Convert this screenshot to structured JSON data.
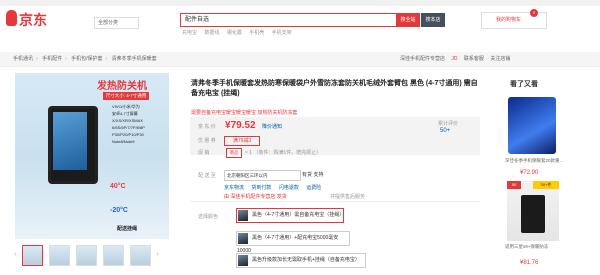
{
  "header": {
    "logo_text": "京东",
    "category_button": "全部分类",
    "search_value": "配件自选",
    "search_button": "搜全站",
    "search_shop_button": "搜本店",
    "hot_words": [
      "充电宝",
      "数据线",
      "钢化膜",
      "手机壳",
      "手机支架"
    ],
    "cart_label": "我的购物车",
    "cart_count": "0"
  },
  "breadcrumb": [
    "手机通讯",
    "手机配件",
    "手机包/保护套",
    "清弗冬季手机保暖套"
  ],
  "shop_links": [
    "深佳手机配件专营店",
    "JD",
    "联系客服",
    "关注店铺"
  ],
  "gallery": {
    "img_title": "发热防关机",
    "img_sub": "尺寸大小: 4-7寸通用",
    "img_specs": [
      "VIVO/小米/华为",
      "安卓4-7寸屏幕",
      "X/XS/XR/XSMAX",
      "6/6S/6P/7/7P/8/8P",
      "P30/P20/P10/P30",
      "Note8/Note9",
      "配件齐全"
    ],
    "hot_temp": "40°C",
    "cold_temp": "-20°C",
    "foot": "配送挂绳",
    "thumb_count": 5
  },
  "product": {
    "title": "清弗冬季手机保暖套发热防寒保暖袋户外雪防冻套防关机毛绒外套臂包 黑色 (4-7寸通用) 需自备充电宝 (挂绳)",
    "promo_text": "需要自备充电宝暖宝暖宝暖宝 加热防关机防冻套",
    "price_label": "京 东 价",
    "currency": "¥",
    "price": "79.52",
    "notify": "降价通知",
    "cumulative_label": "累计评价",
    "cumulative_value": "50+",
    "coupon_label": "优 惠 券",
    "coupon_tag": "满79减3",
    "promo_label": "促 销",
    "promo_tag": "赠品",
    "promo_desc": "× 1 （条件：购满1件，赠完即止）",
    "delivery_label": "配 送 至",
    "delivery_value": "北京朝阳区三环以内",
    "delivery_state": "有货 支持",
    "delivery_tags": [
      "京东物流",
      "货到付款",
      "闪电退款",
      "运费险"
    ],
    "ship_label": "",
    "ship_shop": "由 深佳手机配件专营店 发货",
    "ship_sub": "并提供售后服务",
    "color_label": "选择颜色",
    "options": [
      "黑色（4-7寸通用）需自备充电宝（挂绳）",
      "黑色（4-7寸通用）+配充电宝5000毫安10000",
      "黑色升级款加长无需取手机+挂绳（自备充电宝）"
    ]
  },
  "side": {
    "title": "看了又看",
    "item1_text": "深佳冬季手机保暖套20款重...",
    "item1_price": "¥72.90",
    "item2_tag": "50",
    "item2_tag2": "50+件",
    "item2_text": "适用三星s9+保暖防冻",
    "item2_price": "¥81.76"
  },
  "colors": {
    "accent": "#e4393c",
    "link": "#005ea7",
    "dark_btn": "#474e5d"
  }
}
